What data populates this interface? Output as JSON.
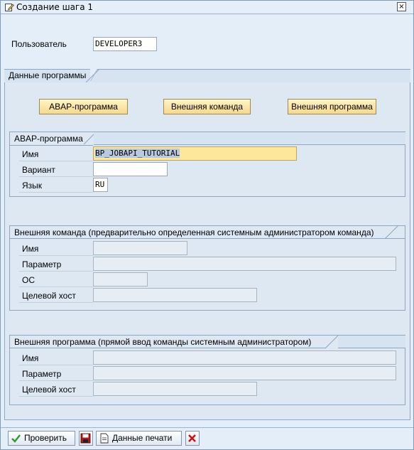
{
  "window": {
    "title": "Создание шага  1",
    "close_symbol": "×"
  },
  "user": {
    "label": "Пользователь",
    "value": "DEVELOPER3"
  },
  "program_data": {
    "header": "Данные программы",
    "buttons": {
      "abap": "ABAP-программа",
      "ext_cmd": "Внешняя команда",
      "ext_prog": "Внешняя программа"
    }
  },
  "abap": {
    "header": "ABAP-программа",
    "name_label": "Имя",
    "name_value": "BP_JOBAPI_TUTORIAL",
    "variant_label": "Вариант",
    "variant_value": "",
    "lang_label": "Язык",
    "lang_value": "RU"
  },
  "ext_command": {
    "header": "Внешняя команда (предварительно определенная системным администратором команда)",
    "name_label": "Имя",
    "param_label": "Параметр",
    "os_label": "ОС",
    "host_label": "Целевой хост"
  },
  "ext_program": {
    "header": "Внешняя программа (прямой ввод команды системным администратором)",
    "name_label": "Имя",
    "param_label": "Параметр",
    "host_label": "Целевой хост"
  },
  "toolbar": {
    "check": "Проверить",
    "print": "Данные печати"
  },
  "colors": {
    "background": "#e4eef8",
    "button_yellow": "#f6d98b",
    "active_field": "#fde79b",
    "cancel_red": "#cc1111",
    "check_green": "#2e9a2e"
  }
}
